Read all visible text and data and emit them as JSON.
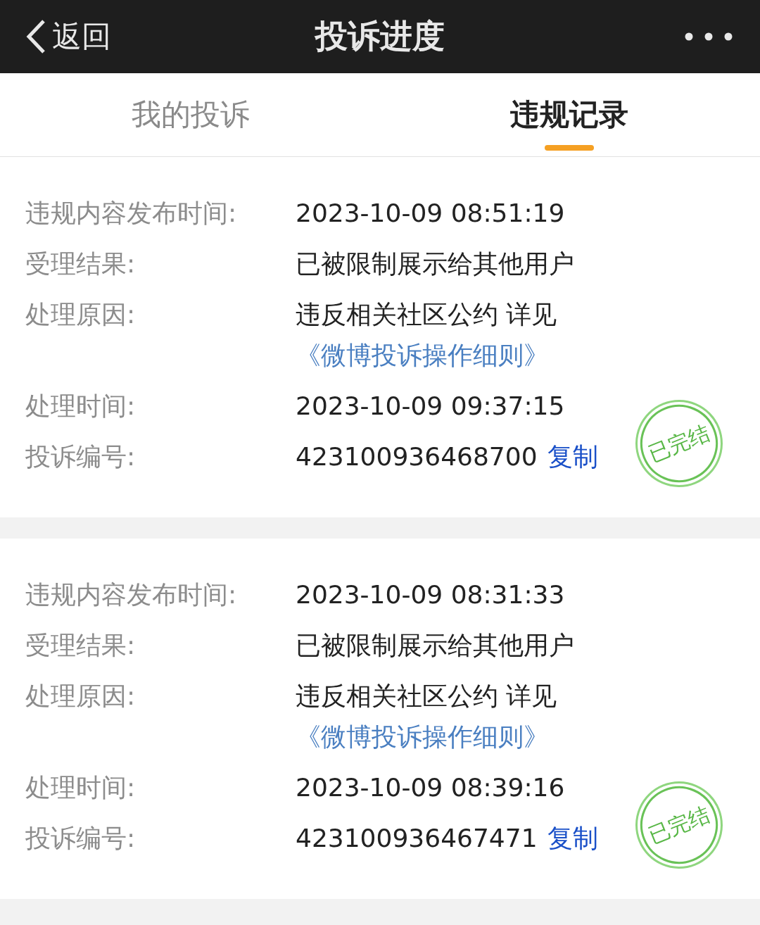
{
  "nav": {
    "back": "返回",
    "title": "投诉进度"
  },
  "tabs": [
    {
      "label": "我的投诉",
      "selected": false
    },
    {
      "label": "违规记录",
      "selected": true
    }
  ],
  "records": [
    {
      "fields": [
        {
          "kind": "text",
          "label": "违规内容发布时间:",
          "value": "2023-10-09 08:51:19"
        },
        {
          "kind": "text",
          "label": "受理结果:",
          "value": "已被限制展示给其他用户"
        },
        {
          "kind": "reason",
          "label": "处理原因:",
          "value": "违反相关社区公约 详见",
          "link": "《微博投诉操作细则》"
        },
        {
          "kind": "text",
          "label": "处理时间:",
          "value": "2023-10-09 09:37:15"
        },
        {
          "kind": "id",
          "label": "投诉编号:",
          "value": "423100936468700",
          "link": "复制"
        }
      ],
      "stamp": "已完结"
    },
    {
      "fields": [
        {
          "kind": "text",
          "label": "违规内容发布时间:",
          "value": "2023-10-09 08:31:33"
        },
        {
          "kind": "text",
          "label": "受理结果:",
          "value": "已被限制展示给其他用户"
        },
        {
          "kind": "reason",
          "label": "处理原因:",
          "value": "违反相关社区公约 详见",
          "link": "《微博投诉操作细则》"
        },
        {
          "kind": "text",
          "label": "处理时间:",
          "value": "2023-10-09 08:39:16"
        },
        {
          "kind": "id",
          "label": "投诉编号:",
          "value": "423100936467471",
          "link": "复制"
        }
      ],
      "stamp": "已完结"
    }
  ]
}
